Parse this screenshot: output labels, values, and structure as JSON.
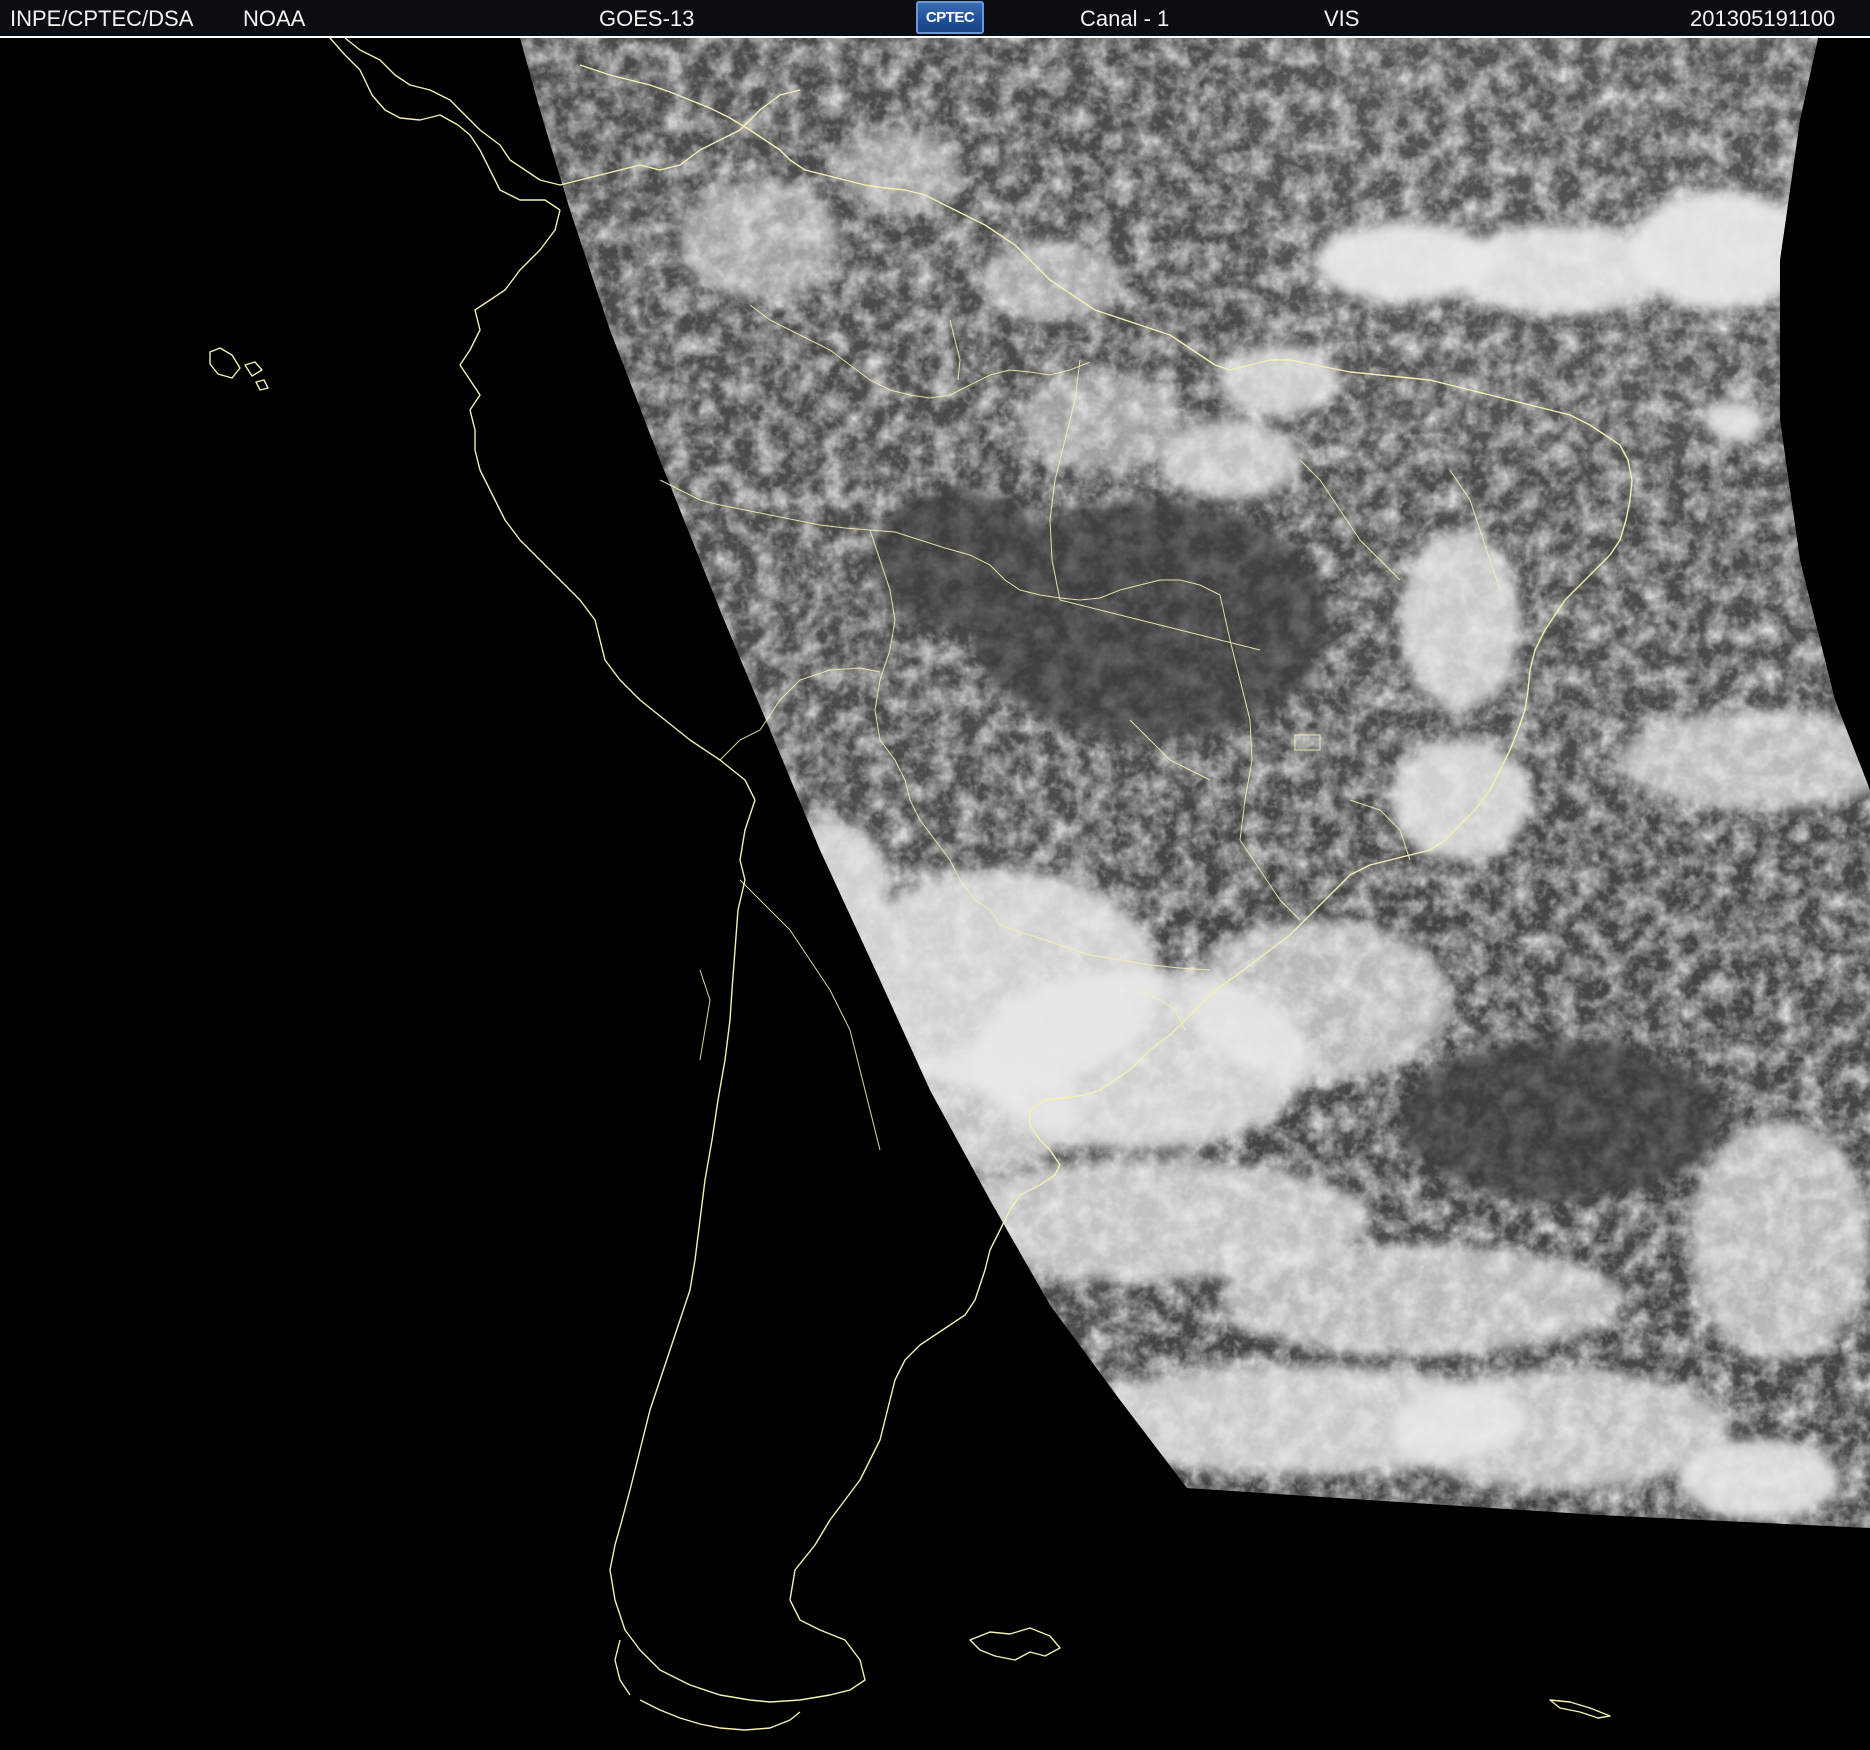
{
  "header": {
    "agency": "INPE/CPTEC/DSA",
    "partner": "NOAA",
    "satellite": "GOES-13",
    "logo_text": "CPTEC",
    "channel": "Canal - 1",
    "band": "VIS",
    "timestamp": "201305191100"
  },
  "map": {
    "region": "South America",
    "coastline_color": "#f4f0b0",
    "cloud_color": "#e8e8e8",
    "land_tone": "#5a5a5a",
    "ocean_tone": "#4a4a4a",
    "night_color": "#000000"
  }
}
